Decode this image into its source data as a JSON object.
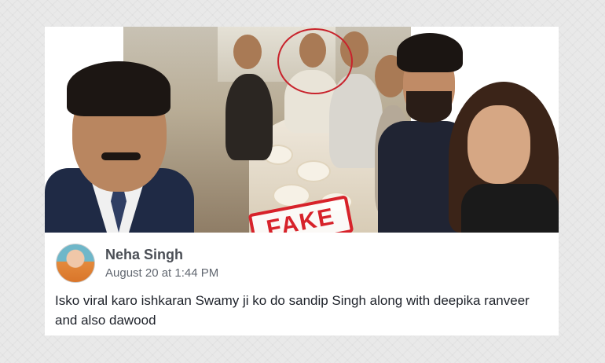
{
  "stamp": {
    "label": "FAKE",
    "color": "#d7222a"
  },
  "post": {
    "author": "Neha Singh",
    "timestamp": "August 20 at 1:44 PM",
    "text": "Isko viral karo ishkaran Swamy ji ko do sandip Singh along with deepika ranveer and also dawood"
  },
  "icons": {
    "avatar": "profile-photo"
  }
}
